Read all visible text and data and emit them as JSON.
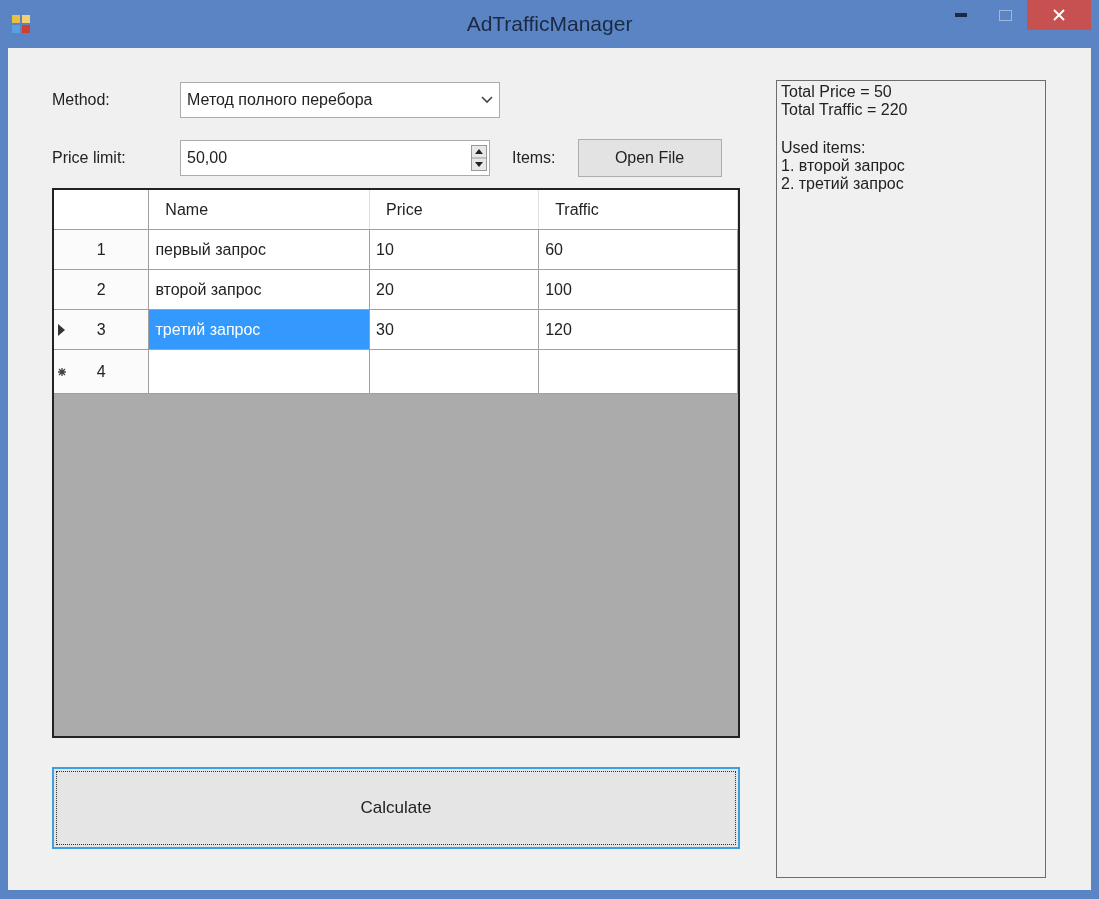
{
  "window": {
    "title": "AdTrafficManager"
  },
  "method": {
    "label": "Method:",
    "value": "Метод полного перебора"
  },
  "price_limit": {
    "label": "Price limit:",
    "value": "50,00"
  },
  "items": {
    "label": "Items:",
    "button": "Open File"
  },
  "table": {
    "columns": [
      "Name",
      "Price",
      "Traffic"
    ],
    "rows": [
      {
        "number": "1",
        "kind": "none",
        "cells": [
          {
            "text": "первый запрос",
            "selected": false
          },
          {
            "text": "10",
            "selected": false
          },
          {
            "text": "60",
            "selected": false
          }
        ]
      },
      {
        "number": "2",
        "kind": "none",
        "cells": [
          {
            "text": "второй запрос",
            "selected": false
          },
          {
            "text": "20",
            "selected": false
          },
          {
            "text": "100",
            "selected": false
          }
        ]
      },
      {
        "number": "3",
        "kind": "current",
        "cells": [
          {
            "text": "третий запрос",
            "selected": true
          },
          {
            "text": "30",
            "selected": false
          },
          {
            "text": "120",
            "selected": false
          }
        ]
      },
      {
        "number": "4",
        "kind": "new",
        "cells": []
      }
    ]
  },
  "calculate_button": {
    "label": "Calculate"
  },
  "result": {
    "totals": [
      "Total Price = 50",
      "Total Traffic = 220"
    ],
    "used_items_heading": "Used items:",
    "used_items": [
      "1. второй запрос",
      "2. третий запрос"
    ]
  }
}
